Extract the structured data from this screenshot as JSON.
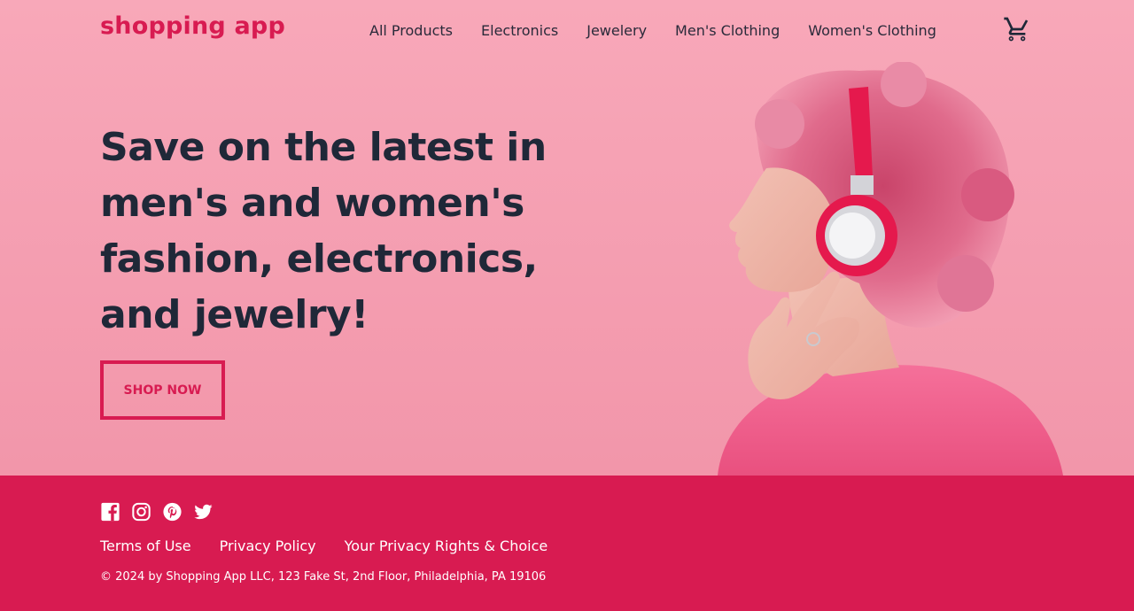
{
  "header": {
    "logo": "shopping app",
    "nav": [
      "All Products",
      "Electronics",
      "Jewelery",
      "Men's Clothing",
      "Women's Clothing"
    ],
    "cart_icon": "shopping-cart-icon"
  },
  "hero": {
    "headline": "Save on the latest in men's and women's fashion, electronics, and jewelry!",
    "cta_label": "SHOP NOW",
    "image_icon": "woman-with-headphones-image"
  },
  "footer": {
    "social_icons": [
      "facebook-icon",
      "instagram-icon",
      "pinterest-icon",
      "twitter-icon"
    ],
    "links": [
      "Terms of Use",
      "Privacy Policy",
      "Your Privacy Rights & Choice"
    ],
    "copyright": "© 2024 by Shopping App LLC, 123 Fake St, 2nd Floor, Philadelphia, PA 19106"
  },
  "colors": {
    "brand": "#d81b51",
    "hero_bg": "#f7a1b3",
    "text_dark": "#1f2838"
  }
}
